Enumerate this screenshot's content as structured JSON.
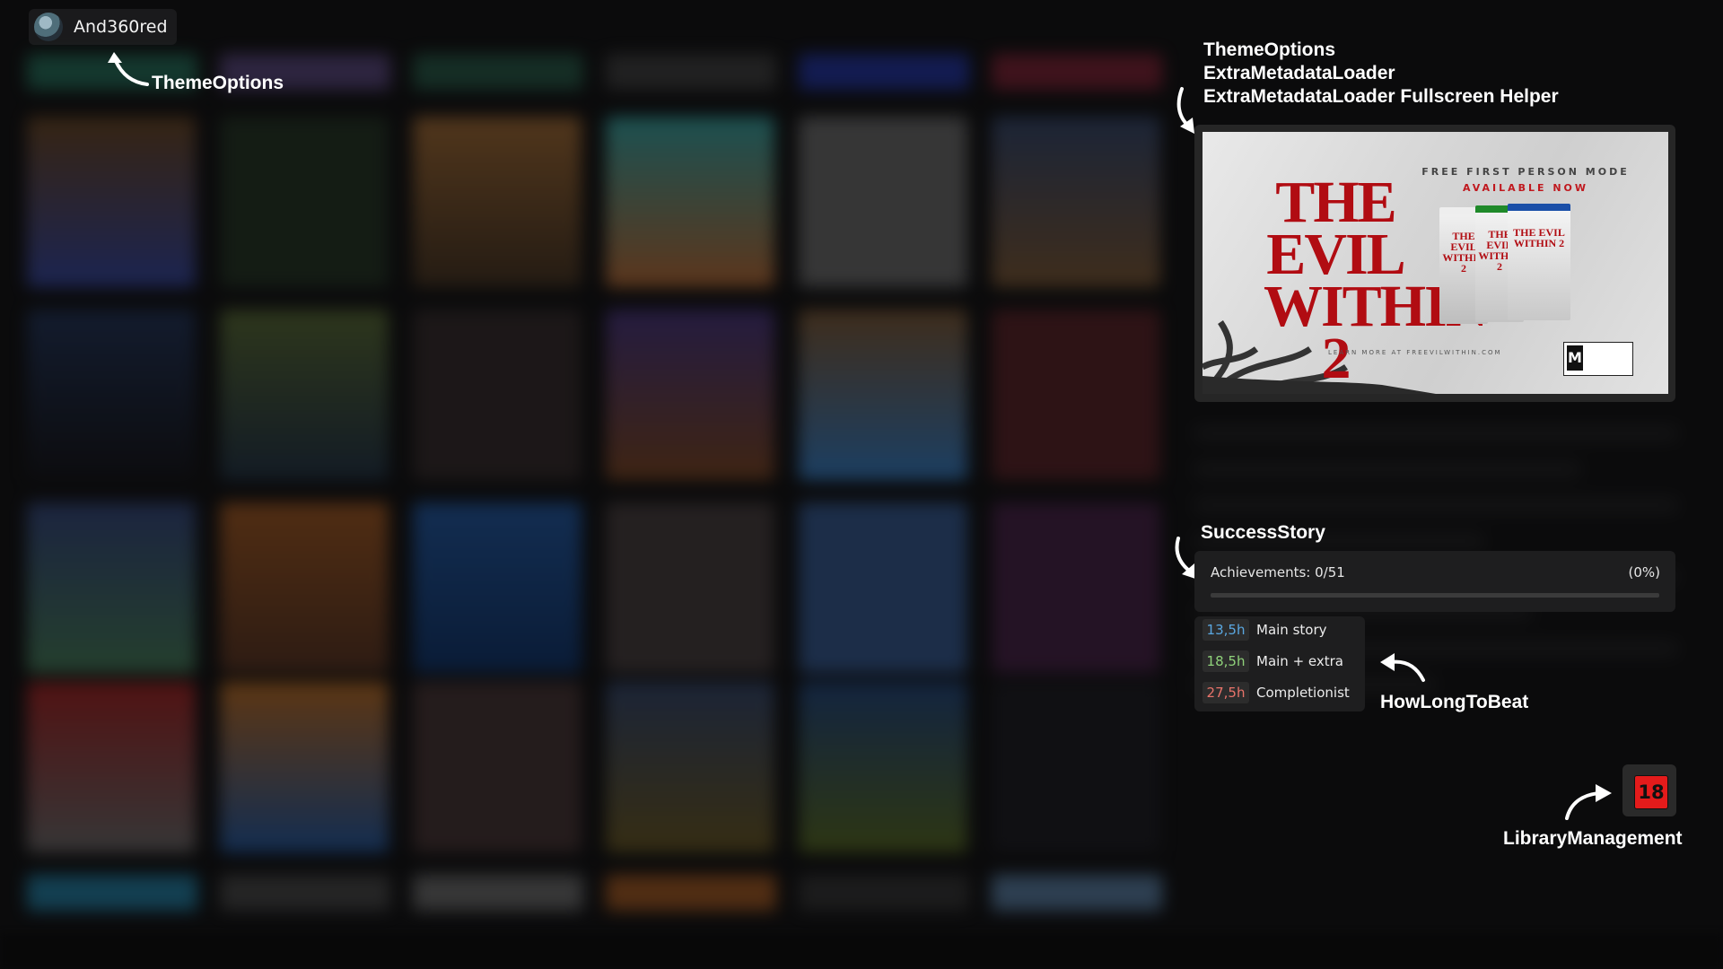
{
  "profile": {
    "username": "And360red"
  },
  "annotations": {
    "theme_options_top": "ThemeOptions",
    "extra_metadata": [
      "ThemeOptions",
      "ExtraMetadataLoader",
      "ExtraMetadataLoader Fullscreen Helper"
    ],
    "success_story": "SuccessStory",
    "how_long_to_beat": "HowLongToBeat",
    "library_management": "LibraryManagement"
  },
  "video": {
    "game_title": "THE EVIL WITHIN 2",
    "headline_1": "FREE FIRST PERSON MODE",
    "headline_2": "AVAILABLE NOW",
    "box_title": "THE EVIL WITHIN 2",
    "url": "LEARN MORE AT FREEVILWITHIN.COM",
    "rating": "M"
  },
  "success_story": {
    "label": "Achievements: 0/51",
    "percent_text": "(0%)",
    "progress": 0
  },
  "hltb": {
    "rows": [
      {
        "time": "13,5h",
        "name": "Main story",
        "color": "#5aa7e0"
      },
      {
        "time": "18,5h",
        "name": "Main + extra",
        "color": "#8fd17a"
      },
      {
        "time": "27,5h",
        "name": "Completionist",
        "color": "#e8736a"
      }
    ]
  },
  "age_rating": {
    "value": "18",
    "color": "#e41b1b"
  },
  "colors": {
    "background": "#0b0b0c",
    "panel": "#1e1e1f",
    "accent_red": "#b10c12"
  }
}
